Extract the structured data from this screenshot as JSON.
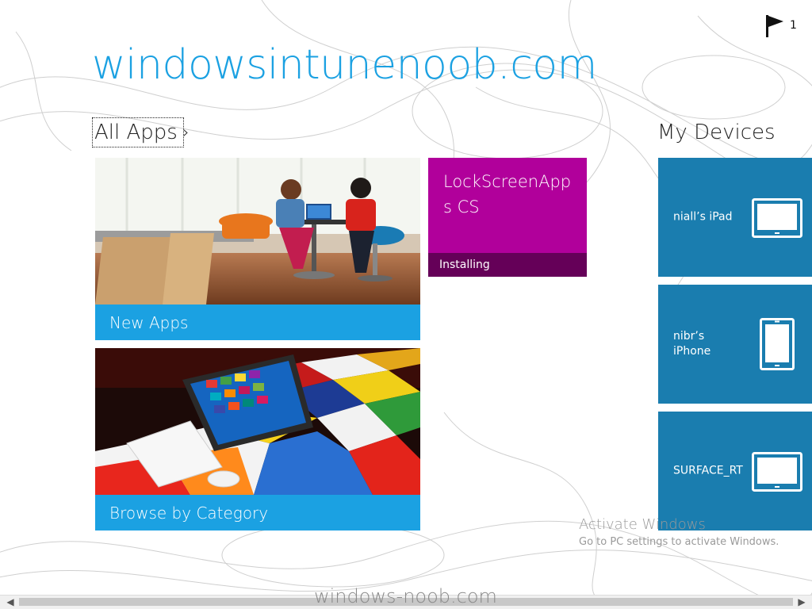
{
  "header": {
    "site_title": "windowsintunenoob.com",
    "notifications_icon": "flag-icon",
    "notifications_count": "1"
  },
  "all_apps": {
    "label": "All Apps",
    "chevron": "›",
    "chevron_icon": "chevron-right-icon"
  },
  "tiles": {
    "new_apps": {
      "label": "New Apps",
      "color": "#1ba1e2"
    },
    "browse_by_category": {
      "label": "Browse by Category",
      "color": "#1ba1e2"
    },
    "lockscreen_app": {
      "name": "LockScreenApps CS",
      "status": "Installing",
      "color": "#b1009b",
      "status_color": "#650058"
    }
  },
  "my_devices": {
    "title": "My Devices",
    "color": "#1a7daf",
    "devices": [
      {
        "name": "niall’s iPad",
        "icon": "tablet-landscape-icon"
      },
      {
        "name": "nibr’s iPhone",
        "icon": "phone-portrait-icon"
      },
      {
        "name": "SURFACE_RT",
        "icon": "tablet-landscape-icon"
      }
    ]
  },
  "activation_notice": {
    "title": "Activate Windows",
    "subtitle": "Go to PC settings to activate Windows."
  },
  "scrollbar": {
    "left_arrow": "◀",
    "right_arrow": "▶"
  },
  "watermark": "windows-noob.com"
}
